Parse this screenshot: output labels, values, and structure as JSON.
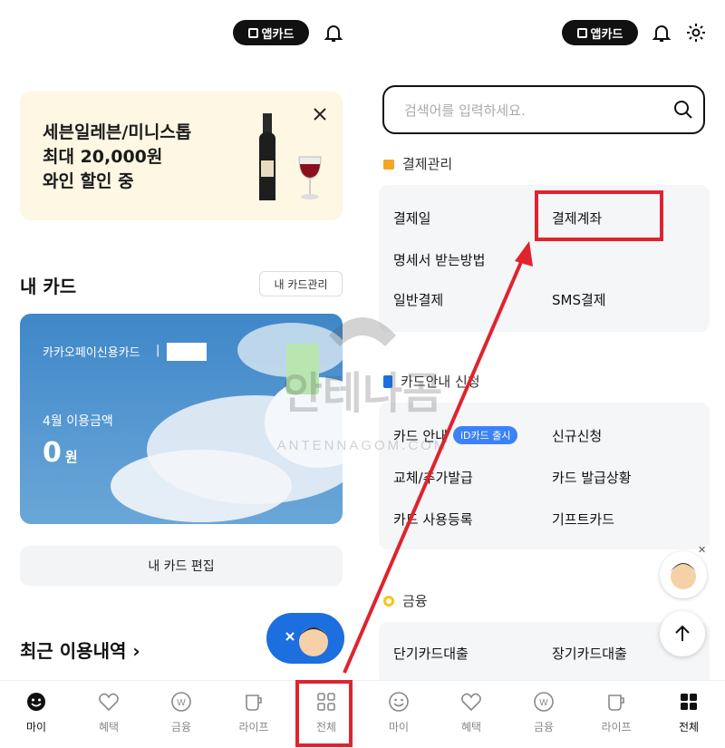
{
  "left": {
    "appcard_label": "앱카드",
    "promo": {
      "line1": "세븐일레븐/미니스톱",
      "line2": "최대 20,000원",
      "line3": "와인 할인 중"
    },
    "my_card": {
      "title": "내 카드",
      "manage_label": "내 카드관리",
      "card_name": "카카오페이신용카드",
      "separator": "|",
      "usage_label": "4월 이용금액",
      "amount": "0",
      "amount_unit": "원",
      "edit_label": "내 카드 편집"
    },
    "recent_title": "최근 이용내역"
  },
  "right": {
    "appcard_label": "앱카드",
    "search_placeholder": "검색어를 입력하세요.",
    "groups": [
      {
        "title": "결제관리",
        "items": [
          "결제일",
          "결제계좌",
          "명세서 받는방법",
          "일반결제",
          "SMS결제"
        ]
      },
      {
        "title": "카드안내 신청",
        "items": [
          "카드 안내",
          "신규신청",
          "교체/추가발급",
          "카드 발급상황",
          "카드 사용등록",
          "기프트카드"
        ],
        "badge": "iD카드 출시"
      },
      {
        "title": "금융",
        "items": [
          "단기카드대출",
          "장기카드대출"
        ]
      }
    ]
  },
  "nav": {
    "items": [
      "마이",
      "혜택",
      "금융",
      "라이프",
      "전체"
    ]
  },
  "watermark": {
    "text": "안테나곰",
    "subtext": "ANTENNAGOM.COM"
  },
  "colors": {
    "highlight": "#e0232e",
    "promo_bg": "#fdf7e3",
    "accent_blue": "#3b82f6",
    "group_bg": "#f5f6f8"
  }
}
